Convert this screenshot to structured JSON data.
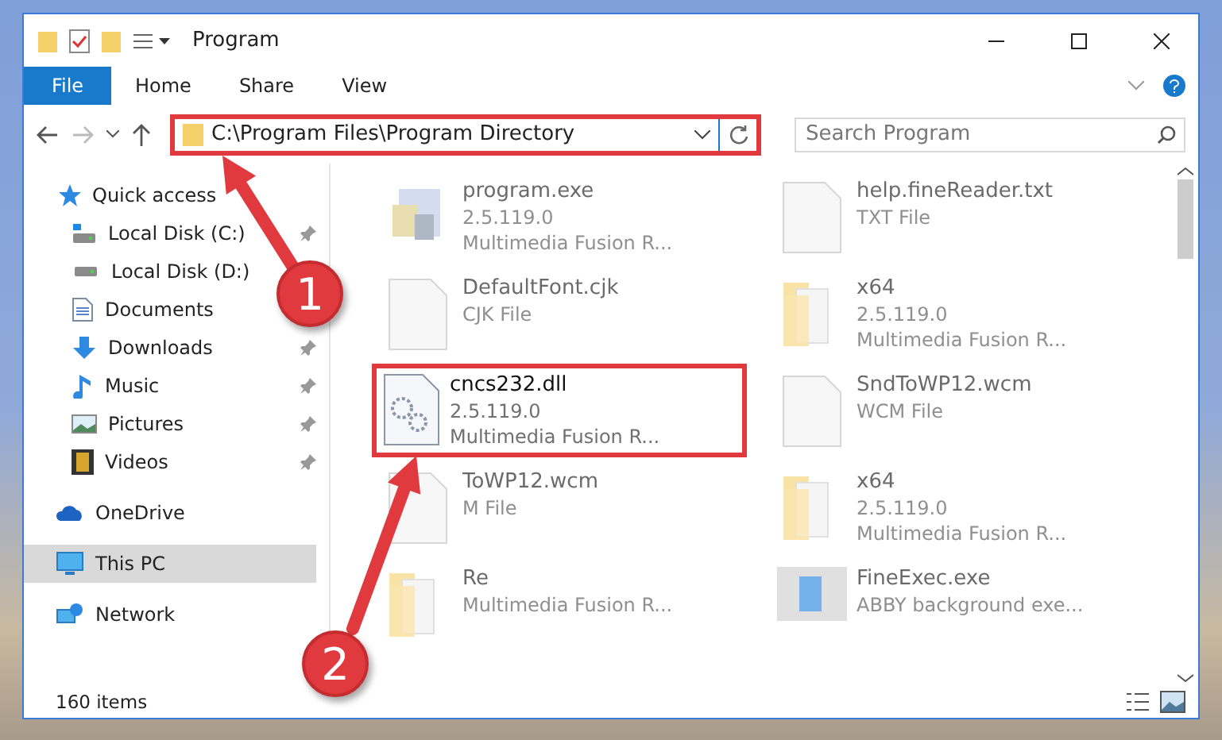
{
  "window": {
    "title": "Program"
  },
  "file_tab": "File",
  "tabs": [
    "Home",
    "Share",
    "View"
  ],
  "address": {
    "path": "C:\\Program Files\\Program Directory",
    "highlighted": true
  },
  "search": {
    "placeholder": "Search Program"
  },
  "nav": [
    {
      "label": "Quick access",
      "kind": "star",
      "selected": false,
      "children": [
        {
          "label": "Local Disk (C:)",
          "kind": "disk-c",
          "pinned": true,
          "selected": false
        },
        {
          "label": "Local Disk (D:)",
          "kind": "disk",
          "selected": false
        },
        {
          "label": "Documents",
          "kind": "document",
          "selected": false
        },
        {
          "label": "Downloads",
          "kind": "download",
          "pinned": true,
          "selected": false
        },
        {
          "label": "Music",
          "kind": "music",
          "pinned": true,
          "selected": false
        },
        {
          "label": "Pictures",
          "kind": "picture",
          "pinned": true,
          "selected": false
        },
        {
          "label": "Videos",
          "kind": "video",
          "pinned": true,
          "selected": false
        }
      ]
    },
    {
      "label": "OneDrive",
      "kind": "cloud",
      "selected": false
    },
    {
      "label": "This PC",
      "kind": "pc",
      "selected": true
    },
    {
      "label": "Network",
      "kind": "network",
      "selected": false
    }
  ],
  "files": [
    {
      "name": "program.exe",
      "lines": [
        "2.5.119.0",
        "Multimedia Fusion R..."
      ],
      "kind": "app",
      "faded": true,
      "highlighted": false
    },
    {
      "name": "help.fineReader.txt",
      "lines": [
        "TXT File"
      ],
      "kind": "doc",
      "faded": true,
      "highlighted": false
    },
    {
      "name": "DefaultFont.cjk",
      "lines": [
        "CJK File"
      ],
      "kind": "doc",
      "faded": true,
      "highlighted": false
    },
    {
      "name": "x64",
      "lines": [
        "2.5.119.0",
        "Multimedia Fusion R..."
      ],
      "kind": "folder",
      "faded": true,
      "highlighted": false
    },
    {
      "name": "cncs232.dll",
      "lines": [
        "2.5.119.0",
        "Multimedia Fusion R..."
      ],
      "kind": "dll",
      "faded": false,
      "highlighted": true
    },
    {
      "name": "SndToWP12.wcm",
      "lines": [
        "WCM File"
      ],
      "kind": "doc",
      "faded": true,
      "highlighted": false
    },
    {
      "name": "ToWP12.wcm",
      "lines": [
        "M File"
      ],
      "kind": "doc",
      "faded": true,
      "highlighted": false
    },
    {
      "name": "x64",
      "lines": [
        "2.5.119.0",
        "Multimedia Fusion R..."
      ],
      "kind": "folder",
      "faded": true,
      "highlighted": false
    },
    {
      "name": "Re",
      "lines": [
        "Multimedia Fusion R..."
      ],
      "kind": "folder",
      "faded": true,
      "highlighted": false
    },
    {
      "name": "FineExec.exe",
      "lines": [
        "ABBY background exe..."
      ],
      "kind": "window",
      "faded": true,
      "highlighted": false
    }
  ],
  "status_bar": {
    "count": "160 items"
  },
  "annotations": [
    {
      "number": "1"
    },
    {
      "number": "2"
    }
  ]
}
